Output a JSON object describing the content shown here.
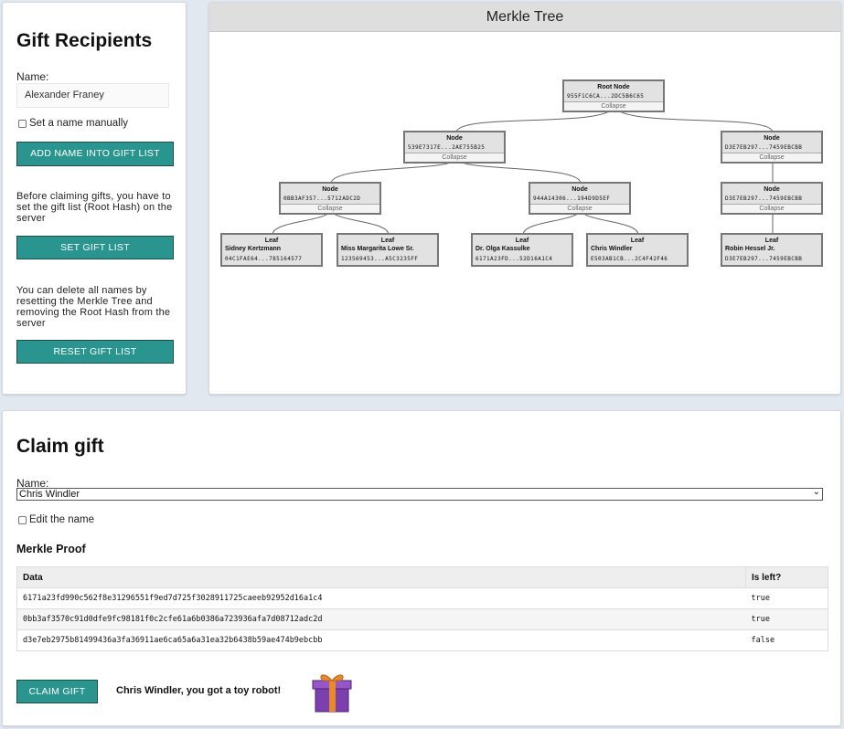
{
  "recipients": {
    "title": "Gift Recipients",
    "name_label": "Name:",
    "name_value": "Alexander Franey",
    "manual_checkbox_label": "Set a name manually",
    "add_button": "ADD NAME INTO GIFT LIST",
    "set_info": "Before claiming gifts, you have to set the gift list (Root Hash) on the server",
    "set_button": "SET GIFT LIST",
    "reset_info": "You can delete all names by resetting the Merkle Tree and removing the Root Hash from the server",
    "reset_button": "RESET GIFT LIST"
  },
  "tree": {
    "title": "Merkle Tree",
    "collapse_label": "Collapse",
    "root": {
      "title": "Root Node",
      "hash": "955F1C6CA...2DC5B6C65"
    },
    "nodes": [
      {
        "title": "Node",
        "hash": "539E7317E...2AE755B25"
      },
      {
        "title": "Node",
        "hash": "D3E7EB297...7459EBCBB"
      },
      {
        "title": "Node",
        "hash": "0BB3AF357...5712ADC2D"
      },
      {
        "title": "Node",
        "hash": "944A14306...194D9D5EF"
      },
      {
        "title": "Node",
        "hash": "D3E7EB297...7459EBCBB"
      }
    ],
    "leaves": [
      {
        "title": "Leaf",
        "name": "Sidney Kertzmann",
        "hash": "04C1FAE64...785164577"
      },
      {
        "title": "Leaf",
        "name": "Miss Margarita Lowe Sr.",
        "hash": "123569453...A5C3235FF"
      },
      {
        "title": "Leaf",
        "name": "Dr. Olga Kassulke",
        "hash": "6171A23FD...52D16A1C4"
      },
      {
        "title": "Leaf",
        "name": "Chris Windler",
        "hash": "E503AB1CB...2C4F42F46"
      },
      {
        "title": "Leaf",
        "name": "Robin Hessel Jr.",
        "hash": "D3E7EB297...7459EBCBB"
      }
    ]
  },
  "claim": {
    "title": "Claim gift",
    "name_label": "Name:",
    "selected_name": "Chris Windler",
    "edit_checkbox_label": "Edit the name",
    "proof_title": "Merkle Proof",
    "columns": {
      "data": "Data",
      "is_left": "Is left?"
    },
    "rows": [
      {
        "data": "6171a23fd990c562f8e31296551f9ed7d725f3028911725caeeb92952d16a1c4",
        "is_left": "true"
      },
      {
        "data": "0bb3af3570c91d0dfe9fc98181f0c2cfe61a6b0386a723936afa7d08712adc2d",
        "is_left": "true"
      },
      {
        "data": "d3e7eb2975b81499436a3fa36911ae6ca65a6a31ea32b6438b59ae474b9ebcbb",
        "is_left": "false"
      }
    ],
    "button": "CLAIM GIFT",
    "message": "Chris Windler, you got a toy robot!"
  },
  "colors": {
    "accent": "#2a958f",
    "background": "#e2e8f0",
    "gift_box": "#7b3fae",
    "gift_ribbon": "#e8892a"
  }
}
